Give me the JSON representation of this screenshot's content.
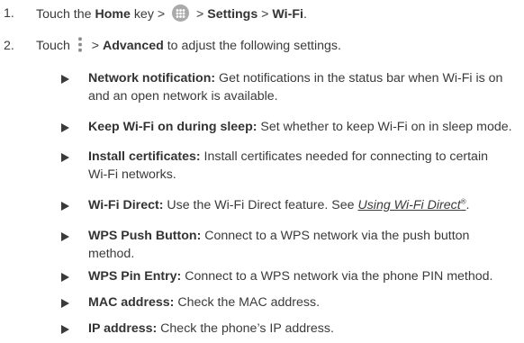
{
  "steps": [
    {
      "number": "1.",
      "prefix": "Touch the ",
      "home": "Home",
      "key_text": " key > ",
      "icon": "apps-grid-icon",
      "after_icon": " > ",
      "settings": "Settings",
      "sep": " > ",
      "wifi": "Wi-Fi",
      "end": "."
    },
    {
      "number": "2.",
      "prefix": "Touch ",
      "icon": "overflow-menu-icon",
      "sep": " > ",
      "advanced": "Advanced",
      "rest": " to adjust the following settings."
    }
  ],
  "bullets": [
    {
      "term": "Network notification:",
      "line1": " Get notifications in the status bar when Wi-Fi is on",
      "line2": "and an open network is available."
    },
    {
      "term": "Keep Wi-Fi on during sleep:",
      "line1": " Set whether to keep Wi-Fi on in sleep mode."
    },
    {
      "term": "Install certificates:",
      "line1": " Install certificates needed for connecting to certain",
      "line2": "Wi-Fi networks."
    },
    {
      "term": "Wi-Fi Direct:",
      "line1": " Use the Wi-Fi Direct feature. See ",
      "link": "Using Wi-Fi Direct",
      "link_sup": "®",
      "line1_end": "."
    },
    {
      "term": "WPS Push Button:",
      "line1": " Connect to a WPS network via the push button",
      "line2": "method."
    },
    {
      "term": "WPS Pin Entry:",
      "line1": " Connect to a WPS network via the phone PIN method."
    },
    {
      "term": "MAC address:",
      "line1": " Check the MAC address."
    },
    {
      "term": "IP address:",
      "line1": " Check the phone’s IP address."
    }
  ],
  "colors": {
    "text": "#3a3a3a",
    "icon_gray": "#aaaaaa",
    "bullet_marker": "#3a3a3a"
  }
}
